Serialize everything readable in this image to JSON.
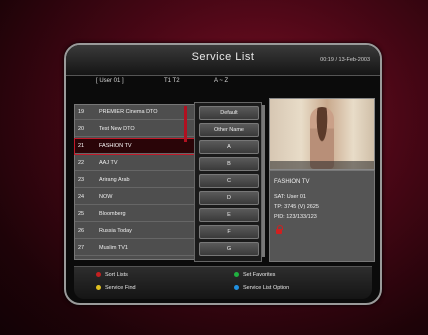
{
  "header": {
    "title": "Service List",
    "clock": "00:19 / 13-Feb-2003",
    "user_tab": "[ User 01 ]",
    "tab_t1t2": "T1  T2",
    "tab_az": "A ~ Z"
  },
  "channels": [
    {
      "num": "19",
      "name": "PREMIER Cinema DTO"
    },
    {
      "num": "20",
      "name": "Test New DTO"
    },
    {
      "num": "21",
      "name": "FASHION TV"
    },
    {
      "num": "22",
      "name": "AAJ TV"
    },
    {
      "num": "23",
      "name": "Arirang Arab"
    },
    {
      "num": "24",
      "name": "NOW"
    },
    {
      "num": "25",
      "name": "Bloomberg"
    },
    {
      "num": "26",
      "name": "Russia Today"
    },
    {
      "num": "27",
      "name": "Muslim TV1"
    }
  ],
  "sort_options": [
    "Default",
    "Other Name",
    "A",
    "B",
    "C",
    "D",
    "E",
    "F",
    "G"
  ],
  "info": {
    "channel": "FASHION TV",
    "sat": "SAT: User 01",
    "tp": "TP: 3745 (V) 2625",
    "pid": "PID: 123/133/123"
  },
  "footer": {
    "sort_lists": "Sort Lists",
    "service_find": "Service Find",
    "set_favorites": "Set Favorites",
    "service_list_option": "Service List Option"
  },
  "colors": {
    "red": "#c42020",
    "yellow": "#e0c020",
    "green": "#20b040",
    "blue": "#2090e0",
    "selection": "#c21a2a"
  }
}
